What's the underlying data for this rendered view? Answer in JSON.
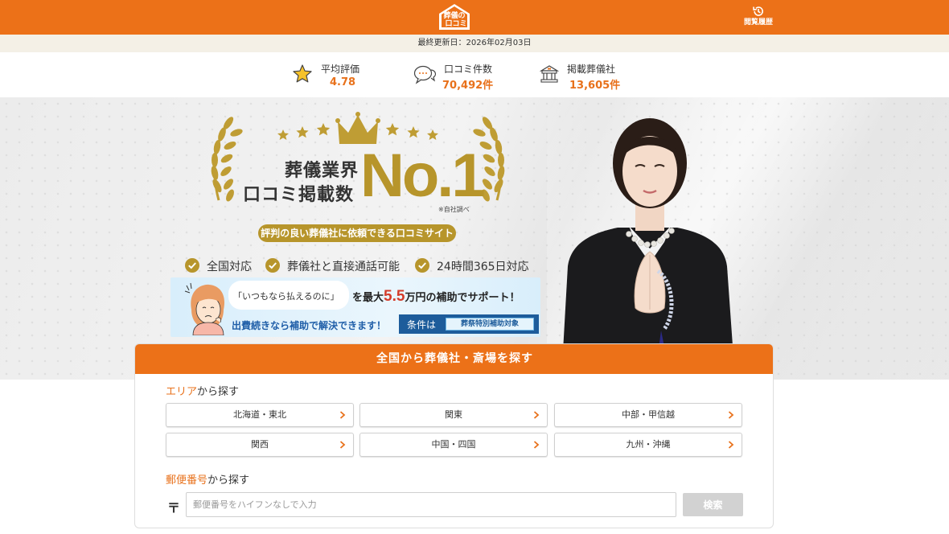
{
  "header": {
    "logo_text_top": "葬儀の",
    "logo_text_bottom": "口コミ",
    "history_label": "閲覧履歴",
    "accent": "#ec7118"
  },
  "updated": "最終更新日：2026年02月03日",
  "stats": [
    {
      "label": "平均評価",
      "value": "4.78",
      "icon": "star-icon"
    },
    {
      "label": "口コミ件数",
      "value": "70,492件",
      "icon": "speech-bubble-icon"
    },
    {
      "label": "掲載葬儀社",
      "value": "13,605件",
      "icon": "funeral-hall-icon"
    }
  ],
  "hero": {
    "line1": "葬儀業界",
    "line2": "口コミ掲載数",
    "no1": "No.1",
    "note": "※自社調べ",
    "pill": "評判の良い葬儀社に依頼できる口コミサイト",
    "checks": [
      "全国対応",
      "葬儀社と直接通話可能",
      "24時間365日対応"
    ],
    "banner": {
      "bubble": "「いつもなら払えるのに」",
      "main_pre": "を最大",
      "main_big": "5.5",
      "main_post": "万円の補助でサポート！",
      "sub": "出費続きなら補助で解決できます！",
      "cond_label": "条件は",
      "cond_tag": "葬祭特別補助対象"
    },
    "gold": "#b7952b"
  },
  "search": {
    "title": "全国から葬儀社・斎場を探す",
    "area_title_hl": "エリア",
    "area_title_rest": "から探す",
    "areas": [
      "北海道・東北",
      "関東",
      "中部・甲信越",
      "関西",
      "中国・四国",
      "九州・沖縄"
    ],
    "postal_title_hl": "郵便番号",
    "postal_title_rest": "から探す",
    "postal_mark": "〒",
    "postal_placeholder": "郵便番号をハイフンなしで入力",
    "search_button": "検索"
  }
}
